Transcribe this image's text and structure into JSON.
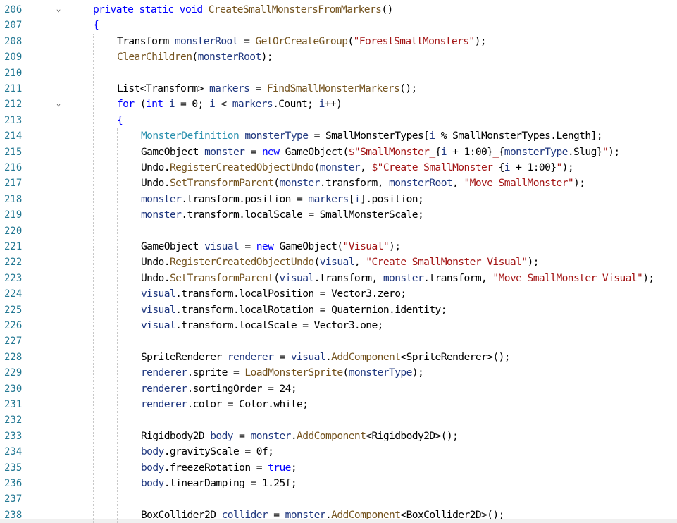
{
  "editor": {
    "lines": [
      {
        "n": "206",
        "indent": 1,
        "fold": "chevron-down",
        "segments": [
          {
            "t": "private static void ",
            "c": "kw"
          },
          {
            "t": "CreateSmallMonstersFromMarkers",
            "c": "fn"
          },
          {
            "t": "()",
            "c": ""
          }
        ]
      },
      {
        "n": "207",
        "indent": 1,
        "fold": "",
        "segments": [
          {
            "t": "{",
            "c": "kw"
          }
        ]
      },
      {
        "n": "208",
        "indent": 2,
        "fold": "",
        "segments": [
          {
            "t": "Transform ",
            "c": ""
          },
          {
            "t": "monsterRoot",
            "c": "var"
          },
          {
            "t": " = ",
            "c": ""
          },
          {
            "t": "GetOrCreateGroup",
            "c": "fn"
          },
          {
            "t": "(",
            "c": ""
          },
          {
            "t": "\"ForestSmallMonsters\"",
            "c": "str"
          },
          {
            "t": ");",
            "c": ""
          }
        ]
      },
      {
        "n": "209",
        "indent": 2,
        "fold": "",
        "segments": [
          {
            "t": "ClearChildren",
            "c": "fn"
          },
          {
            "t": "(",
            "c": ""
          },
          {
            "t": "monsterRoot",
            "c": "var"
          },
          {
            "t": ");",
            "c": ""
          }
        ]
      },
      {
        "n": "210",
        "indent": 0,
        "fold": "",
        "segments": []
      },
      {
        "n": "211",
        "indent": 2,
        "fold": "",
        "segments": [
          {
            "t": "List<Transform> ",
            "c": ""
          },
          {
            "t": "markers",
            "c": "var"
          },
          {
            "t": " = ",
            "c": ""
          },
          {
            "t": "FindSmallMonsterMarkers",
            "c": "fn"
          },
          {
            "t": "();",
            "c": ""
          }
        ]
      },
      {
        "n": "212",
        "indent": 2,
        "fold": "chevron-down",
        "segments": [
          {
            "t": "for",
            "c": "kw"
          },
          {
            "t": " (",
            "c": ""
          },
          {
            "t": "int",
            "c": "kw"
          },
          {
            "t": " ",
            "c": ""
          },
          {
            "t": "i",
            "c": "var"
          },
          {
            "t": " = 0; ",
            "c": ""
          },
          {
            "t": "i",
            "c": "var"
          },
          {
            "t": " < ",
            "c": ""
          },
          {
            "t": "markers",
            "c": "var"
          },
          {
            "t": ".Count; ",
            "c": ""
          },
          {
            "t": "i",
            "c": "var"
          },
          {
            "t": "++)",
            "c": ""
          }
        ]
      },
      {
        "n": "213",
        "indent": 2,
        "fold": "",
        "segments": [
          {
            "t": "{",
            "c": "kw"
          }
        ]
      },
      {
        "n": "214",
        "indent": 3,
        "fold": "",
        "segments": [
          {
            "t": "MonsterDefinition",
            "c": "ty"
          },
          {
            "t": " ",
            "c": ""
          },
          {
            "t": "monsterType",
            "c": "var"
          },
          {
            "t": " = SmallMonsterTypes[",
            "c": ""
          },
          {
            "t": "i",
            "c": "var"
          },
          {
            "t": " % SmallMonsterTypes.Length];",
            "c": ""
          }
        ]
      },
      {
        "n": "215",
        "indent": 3,
        "fold": "",
        "segments": [
          {
            "t": "GameObject ",
            "c": ""
          },
          {
            "t": "monster",
            "c": "var"
          },
          {
            "t": " = ",
            "c": ""
          },
          {
            "t": "new",
            "c": "kw"
          },
          {
            "t": " GameObject(",
            "c": ""
          },
          {
            "t": "$\"SmallMonster_",
            "c": "str"
          },
          {
            "t": "{",
            "c": ""
          },
          {
            "t": "i",
            "c": "var"
          },
          {
            "t": " + 1:00}",
            "c": ""
          },
          {
            "t": "_",
            "c": "str"
          },
          {
            "t": "{",
            "c": ""
          },
          {
            "t": "monsterType",
            "c": "var"
          },
          {
            "t": ".Slug}",
            "c": ""
          },
          {
            "t": "\"",
            "c": "str"
          },
          {
            "t": ");",
            "c": ""
          }
        ]
      },
      {
        "n": "216",
        "indent": 3,
        "fold": "",
        "segments": [
          {
            "t": "Undo.",
            "c": ""
          },
          {
            "t": "RegisterCreatedObjectUndo",
            "c": "fn"
          },
          {
            "t": "(",
            "c": ""
          },
          {
            "t": "monster",
            "c": "var"
          },
          {
            "t": ", ",
            "c": ""
          },
          {
            "t": "$\"Create SmallMonster_",
            "c": "str"
          },
          {
            "t": "{",
            "c": ""
          },
          {
            "t": "i",
            "c": "var"
          },
          {
            "t": " + 1:00}",
            "c": ""
          },
          {
            "t": "\"",
            "c": "str"
          },
          {
            "t": ");",
            "c": ""
          }
        ]
      },
      {
        "n": "217",
        "indent": 3,
        "fold": "",
        "segments": [
          {
            "t": "Undo.",
            "c": ""
          },
          {
            "t": "SetTransformParent",
            "c": "fn"
          },
          {
            "t": "(",
            "c": ""
          },
          {
            "t": "monster",
            "c": "var"
          },
          {
            "t": ".transform, ",
            "c": ""
          },
          {
            "t": "monsterRoot",
            "c": "var"
          },
          {
            "t": ", ",
            "c": ""
          },
          {
            "t": "\"Move SmallMonster\"",
            "c": "str"
          },
          {
            "t": ");",
            "c": ""
          }
        ]
      },
      {
        "n": "218",
        "indent": 3,
        "fold": "",
        "segments": [
          {
            "t": "monster",
            "c": "var"
          },
          {
            "t": ".transform.position = ",
            "c": ""
          },
          {
            "t": "markers",
            "c": "var"
          },
          {
            "t": "[",
            "c": ""
          },
          {
            "t": "i",
            "c": "var"
          },
          {
            "t": "].position;",
            "c": ""
          }
        ]
      },
      {
        "n": "219",
        "indent": 3,
        "fold": "",
        "segments": [
          {
            "t": "monster",
            "c": "var"
          },
          {
            "t": ".transform.localScale = SmallMonsterScale;",
            "c": ""
          }
        ]
      },
      {
        "n": "220",
        "indent": 0,
        "fold": "",
        "segments": []
      },
      {
        "n": "221",
        "indent": 3,
        "fold": "",
        "segments": [
          {
            "t": "GameObject ",
            "c": ""
          },
          {
            "t": "visual",
            "c": "var"
          },
          {
            "t": " = ",
            "c": ""
          },
          {
            "t": "new",
            "c": "kw"
          },
          {
            "t": " GameObject(",
            "c": ""
          },
          {
            "t": "\"Visual\"",
            "c": "str"
          },
          {
            "t": ");",
            "c": ""
          }
        ]
      },
      {
        "n": "222",
        "indent": 3,
        "fold": "",
        "segments": [
          {
            "t": "Undo.",
            "c": ""
          },
          {
            "t": "RegisterCreatedObjectUndo",
            "c": "fn"
          },
          {
            "t": "(",
            "c": ""
          },
          {
            "t": "visual",
            "c": "var"
          },
          {
            "t": ", ",
            "c": ""
          },
          {
            "t": "\"Create SmallMonster Visual\"",
            "c": "str"
          },
          {
            "t": ");",
            "c": ""
          }
        ]
      },
      {
        "n": "223",
        "indent": 3,
        "fold": "",
        "segments": [
          {
            "t": "Undo.",
            "c": ""
          },
          {
            "t": "SetTransformParent",
            "c": "fn"
          },
          {
            "t": "(",
            "c": ""
          },
          {
            "t": "visual",
            "c": "var"
          },
          {
            "t": ".transform, ",
            "c": ""
          },
          {
            "t": "monster",
            "c": "var"
          },
          {
            "t": ".transform, ",
            "c": ""
          },
          {
            "t": "\"Move SmallMonster Visual\"",
            "c": "str"
          },
          {
            "t": ");",
            "c": ""
          }
        ]
      },
      {
        "n": "224",
        "indent": 3,
        "fold": "",
        "segments": [
          {
            "t": "visual",
            "c": "var"
          },
          {
            "t": ".transform.localPosition = Vector3.zero;",
            "c": ""
          }
        ]
      },
      {
        "n": "225",
        "indent": 3,
        "fold": "",
        "segments": [
          {
            "t": "visual",
            "c": "var"
          },
          {
            "t": ".transform.localRotation = Quaternion.identity;",
            "c": ""
          }
        ]
      },
      {
        "n": "226",
        "indent": 3,
        "fold": "",
        "segments": [
          {
            "t": "visual",
            "c": "var"
          },
          {
            "t": ".transform.localScale = Vector3.one;",
            "c": ""
          }
        ]
      },
      {
        "n": "227",
        "indent": 0,
        "fold": "",
        "segments": []
      },
      {
        "n": "228",
        "indent": 3,
        "fold": "",
        "segments": [
          {
            "t": "SpriteRenderer ",
            "c": ""
          },
          {
            "t": "renderer",
            "c": "var"
          },
          {
            "t": " = ",
            "c": ""
          },
          {
            "t": "visual",
            "c": "var"
          },
          {
            "t": ".",
            "c": ""
          },
          {
            "t": "AddComponent",
            "c": "fn"
          },
          {
            "t": "<SpriteRenderer>();",
            "c": ""
          }
        ]
      },
      {
        "n": "229",
        "indent": 3,
        "fold": "",
        "segments": [
          {
            "t": "renderer",
            "c": "var"
          },
          {
            "t": ".sprite = ",
            "c": ""
          },
          {
            "t": "LoadMonsterSprite",
            "c": "fn"
          },
          {
            "t": "(",
            "c": ""
          },
          {
            "t": "monsterType",
            "c": "var"
          },
          {
            "t": ");",
            "c": ""
          }
        ]
      },
      {
        "n": "230",
        "indent": 3,
        "fold": "",
        "segments": [
          {
            "t": "renderer",
            "c": "var"
          },
          {
            "t": ".sortingOrder = 24;",
            "c": ""
          }
        ]
      },
      {
        "n": "231",
        "indent": 3,
        "fold": "",
        "segments": [
          {
            "t": "renderer",
            "c": "var"
          },
          {
            "t": ".color = Color.white;",
            "c": ""
          }
        ]
      },
      {
        "n": "232",
        "indent": 0,
        "fold": "",
        "segments": []
      },
      {
        "n": "233",
        "indent": 3,
        "fold": "",
        "segments": [
          {
            "t": "Rigidbody2D ",
            "c": ""
          },
          {
            "t": "body",
            "c": "var"
          },
          {
            "t": " = ",
            "c": ""
          },
          {
            "t": "monster",
            "c": "var"
          },
          {
            "t": ".",
            "c": ""
          },
          {
            "t": "AddComponent",
            "c": "fn"
          },
          {
            "t": "<Rigidbody2D>();",
            "c": ""
          }
        ]
      },
      {
        "n": "234",
        "indent": 3,
        "fold": "",
        "segments": [
          {
            "t": "body",
            "c": "var"
          },
          {
            "t": ".gravityScale = 0f;",
            "c": ""
          }
        ]
      },
      {
        "n": "235",
        "indent": 3,
        "fold": "",
        "segments": [
          {
            "t": "body",
            "c": "var"
          },
          {
            "t": ".freezeRotation = ",
            "c": ""
          },
          {
            "t": "true",
            "c": "kw"
          },
          {
            "t": ";",
            "c": ""
          }
        ]
      },
      {
        "n": "236",
        "indent": 3,
        "fold": "",
        "segments": [
          {
            "t": "body",
            "c": "var"
          },
          {
            "t": ".linearDamping = 1.25f;",
            "c": ""
          }
        ]
      },
      {
        "n": "237",
        "indent": 0,
        "fold": "",
        "segments": []
      },
      {
        "n": "238",
        "indent": 3,
        "fold": "",
        "segments": [
          {
            "t": "BoxCollider2D ",
            "c": ""
          },
          {
            "t": "collider",
            "c": "var"
          },
          {
            "t": " = ",
            "c": ""
          },
          {
            "t": "monster",
            "c": "var"
          },
          {
            "t": ".",
            "c": ""
          },
          {
            "t": "AddComponent",
            "c": "fn"
          },
          {
            "t": "<BoxCollider2D>();",
            "c": ""
          }
        ]
      }
    ]
  }
}
